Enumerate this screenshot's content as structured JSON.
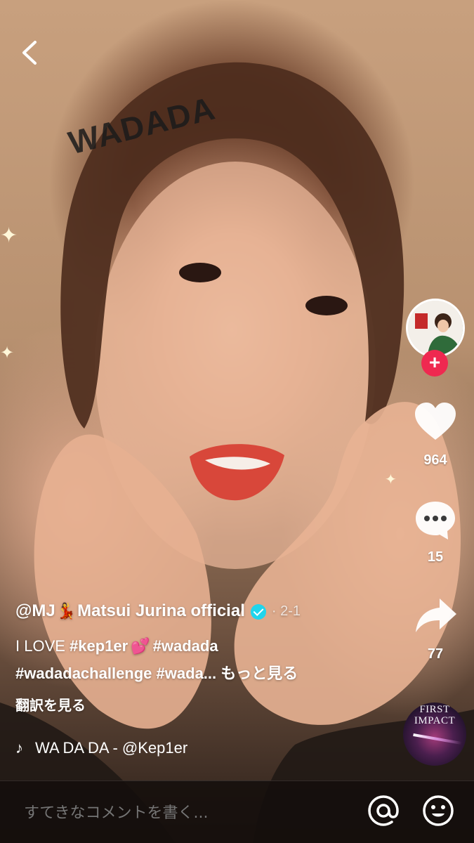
{
  "overlay": {
    "text": "WADADA"
  },
  "creator": {
    "handle": "@MJ",
    "emoji": "💃",
    "display_name": "Matsui Jurina official",
    "date": "· 2-1"
  },
  "caption": {
    "prefix": "I LOVE ",
    "tag1": "#kep1er",
    "hearts": "💕",
    "tag2": "#wadada",
    "tag3": "#wadadachallenge",
    "tag4": "#wada...",
    "more": "もっと見る"
  },
  "translate_label": "翻訳を見る",
  "music": {
    "title": "WA DA DA - @Kep1er",
    "icon": "music-note-icon"
  },
  "stats": {
    "likes": "964",
    "comments": "15",
    "shares": "77"
  },
  "disc": {
    "title_line1": "FIRST",
    "title_line2": "IMPACT"
  },
  "comment": {
    "placeholder": "すてきなコメントを書く..."
  },
  "colors": {
    "follow": "#ef2950",
    "verified": "#20d5ec"
  }
}
